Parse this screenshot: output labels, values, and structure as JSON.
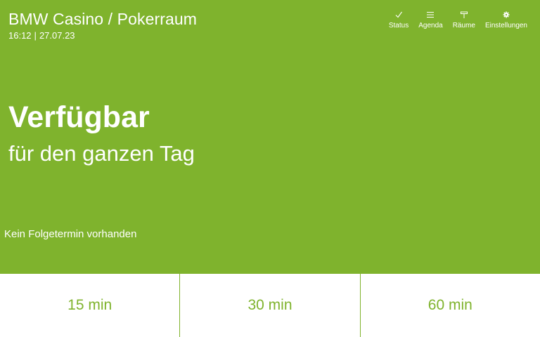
{
  "header": {
    "room_title": "BMW Casino / Pokerraum",
    "time": "16:12",
    "separator": "|",
    "date": "27.07.23"
  },
  "nav": [
    {
      "label": "Status",
      "icon": "check-icon"
    },
    {
      "label": "Agenda",
      "icon": "list-icon"
    },
    {
      "label": "Räume",
      "icon": "rooms-icon"
    },
    {
      "label": "Einstellungen",
      "icon": "gear-icon"
    }
  ],
  "status": {
    "title": "Verfügbar",
    "subtitle": "für den ganzen Tag"
  },
  "next_meeting": "Kein Folgetermin vorhanden",
  "quick_book": [
    {
      "label": "15 min"
    },
    {
      "label": "30 min"
    },
    {
      "label": "60 min"
    }
  ],
  "colors": {
    "accent": "#7fb32d",
    "text_on_accent": "#ffffff",
    "bottom_background": "#ffffff"
  }
}
